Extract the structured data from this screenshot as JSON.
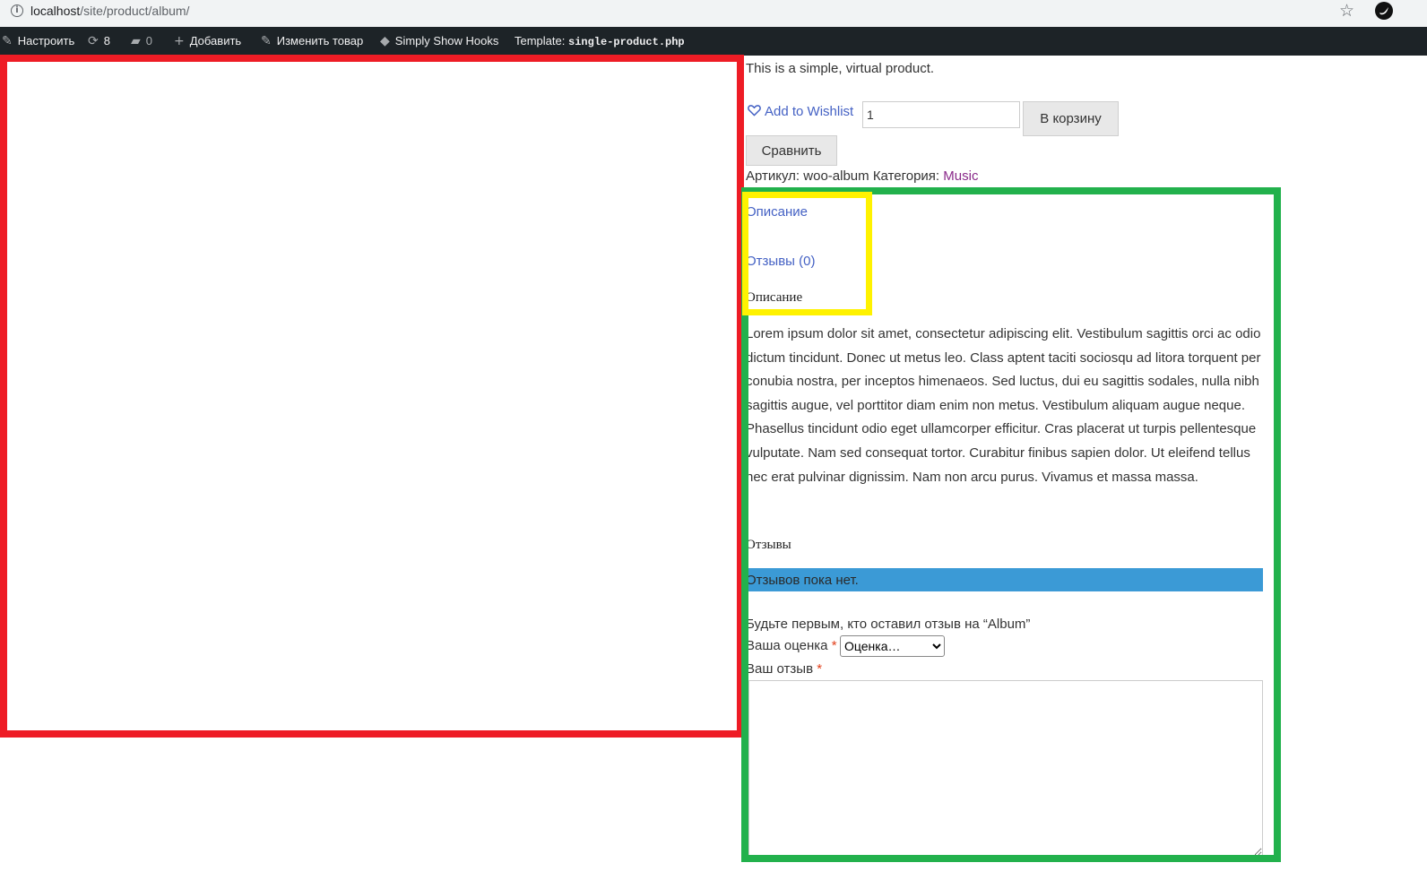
{
  "browser": {
    "url_host": "localhost",
    "url_path": "/site/product/album/"
  },
  "admin_bar": {
    "customize": "Настроить",
    "updates_count": "8",
    "comments_count": "0",
    "add_new": "Добавить",
    "edit_product": "Изменить товар",
    "simply_show_hooks": "Simply Show Hooks",
    "template_label": "Template:",
    "template_file": "single-product.php"
  },
  "product": {
    "short_description": "This is a simple, virtual product.",
    "wishlist_label": "Add to Wishlist",
    "quantity": "1",
    "add_to_cart": "В корзину",
    "compare": "Сравнить",
    "sku_label": "Артикул:",
    "sku": "woo-album",
    "category_label": "Категория:",
    "category": "Music"
  },
  "tabs": {
    "description_tab": "Описание",
    "reviews_tab": "Отзывы (0)"
  },
  "description": {
    "heading": "Описание",
    "text": "Lorem ipsum dolor sit amet, consectetur adipiscing elit. Vestibulum sagittis orci ac odio dictum tincidunt. Donec ut metus leo. Class aptent taciti sociosqu ad litora torquent per conubia nostra, per inceptos himenaeos. Sed luctus, dui eu sagittis sodales, nulla nibh sagittis augue, vel porttitor diam enim non metus. Vestibulum aliquam augue neque. Phasellus tincidunt odio eget ullamcorper efficitur. Cras placerat ut turpis pellentesque vulputate. Nam sed consequat tortor. Curabitur finibus sapien dolor. Ut eleifend tellus nec erat pulvinar dignissim. Nam non arcu purus. Vivamus et massa massa."
  },
  "reviews": {
    "heading": "Отзывы",
    "no_reviews": "Отзывов пока нет.",
    "be_first": "Будьте первым, кто оставил отзыв на “Album”",
    "rating_label": "Ваша оценка",
    "rating_placeholder": "Оценка…",
    "review_label": "Ваш отзыв",
    "required_mark": "*"
  },
  "colors": {
    "annotation_red": "#ee1c25",
    "annotation_green": "#22b14c",
    "annotation_yellow": "#fff200",
    "admin_bar": "#1d2327",
    "notice_bg": "#3b9ad6",
    "link": "#4461c4"
  },
  "icons": {
    "info": "info-icon",
    "bookmark": "star-icon",
    "extension": "bird-icon",
    "customize": "brush-icon",
    "updates": "refresh-icon",
    "comments": "comment-icon",
    "add": "plus-icon",
    "edit": "pencil-icon",
    "hooks": "tag-icon",
    "wishlist": "heart-icon"
  }
}
